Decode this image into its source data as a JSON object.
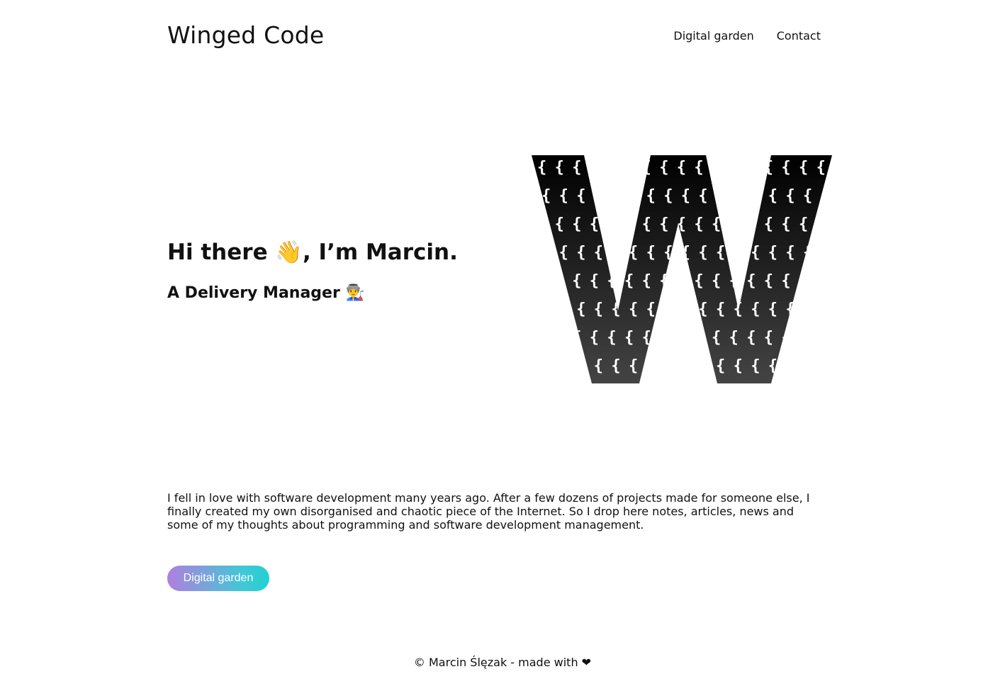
{
  "header": {
    "brand": "Winged Code",
    "nav": [
      {
        "label": "Digital garden"
      },
      {
        "label": "Contact"
      }
    ]
  },
  "hero": {
    "greeting": "Hi there 👋, I’m Marcin.",
    "role": "A Delivery Manager 👨‍🏭"
  },
  "logo": {
    "letter": "W",
    "pattern_glyph": "{",
    "gradient_top": "#000000",
    "gradient_bottom": "#444444"
  },
  "intro": {
    "text": "I fell in love with software development many years ago. After a few dozens of projects made for someone else, I finally created my own disorganised and chaotic piece of the Internet. So I drop here notes, articles, news and some of my thoughts about programming and software development management."
  },
  "cta": {
    "label": "Digital garden",
    "gradient_start": "#b07fe0",
    "gradient_end": "#22d1d1"
  },
  "footer": {
    "text": "© Marcin Ślęzak - made with ❤"
  }
}
